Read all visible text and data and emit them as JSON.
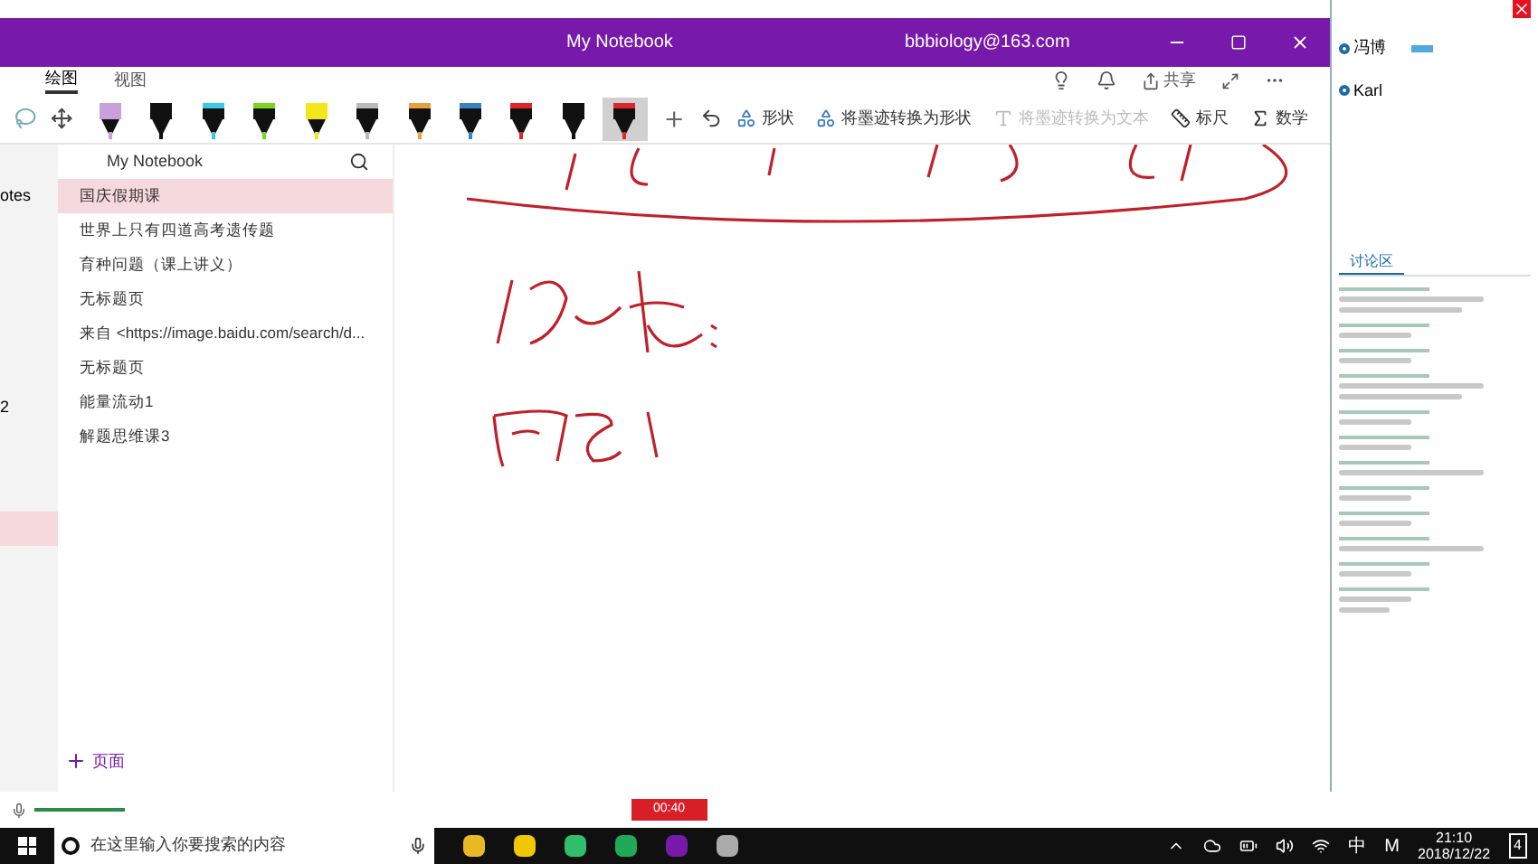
{
  "window": {
    "title": "My Notebook",
    "account": "bbbiology@163.com"
  },
  "ribbon_tabs": [
    {
      "label": "绘图",
      "selected": true
    },
    {
      "label": "视图",
      "selected": false
    }
  ],
  "share": {
    "label": "共享"
  },
  "pens": [
    {
      "kind": "highlighter",
      "color": "#c9a0dc",
      "selected": false
    },
    {
      "kind": "pen",
      "color": "#111111",
      "selected": false
    },
    {
      "kind": "pen",
      "color": "#3cc6e8",
      "selected": false
    },
    {
      "kind": "pen",
      "color": "#7ed321",
      "selected": false
    },
    {
      "kind": "highlighter",
      "color": "#f5e61c",
      "selected": false
    },
    {
      "kind": "pen",
      "color": "#bbbbbb",
      "selected": false
    },
    {
      "kind": "pen",
      "color": "#e8a23c",
      "selected": false
    },
    {
      "kind": "pen",
      "color": "#3b82c4",
      "selected": false
    },
    {
      "kind": "pen",
      "color": "#e0262b",
      "selected": false
    },
    {
      "kind": "pen",
      "color": "#111111",
      "selected": false
    },
    {
      "kind": "pen",
      "color": "#e0262b",
      "selected": true
    }
  ],
  "tools": [
    {
      "label": "形状",
      "disabled": false
    },
    {
      "label": "将墨迹转换为形状",
      "disabled": false
    },
    {
      "label": "将墨迹转换为文本",
      "disabled": true
    },
    {
      "label": "标尺",
      "disabled": false
    },
    {
      "label": "数学",
      "disabled": false
    }
  ],
  "sections": [
    {
      "label": "otes",
      "selected": false
    },
    {
      "label": "2",
      "selected": false
    },
    {
      "selected": true
    }
  ],
  "pages_header": "My Notebook",
  "pages": [
    {
      "title": "国庆假期课",
      "selected": true
    },
    {
      "title": "世界上只有四道高考遗传题",
      "selected": false
    },
    {
      "title": "育种问题（课上讲义）",
      "selected": false
    },
    {
      "title": "无标题页",
      "selected": false
    },
    {
      "title": "来自 <https://image.baidu.com/search/d...",
      "selected": false
    },
    {
      "title": "无标题页",
      "selected": false
    },
    {
      "title": "能量流动1",
      "selected": false
    },
    {
      "title": "解题思维课3",
      "selected": false
    }
  ],
  "add_page": "页面",
  "chat": {
    "members": [
      {
        "name": "冯博",
        "badge": true
      },
      {
        "name": "Karl",
        "badge": false
      }
    ],
    "tab": "讨论区"
  },
  "recorder": {
    "time": "00:40"
  },
  "taskbar": {
    "search_placeholder": "在这里输入你要搜索的内容",
    "ime": "中",
    "ime_mode": "M",
    "time": "21:10",
    "date": "2018/12/22",
    "notifications": "4"
  }
}
